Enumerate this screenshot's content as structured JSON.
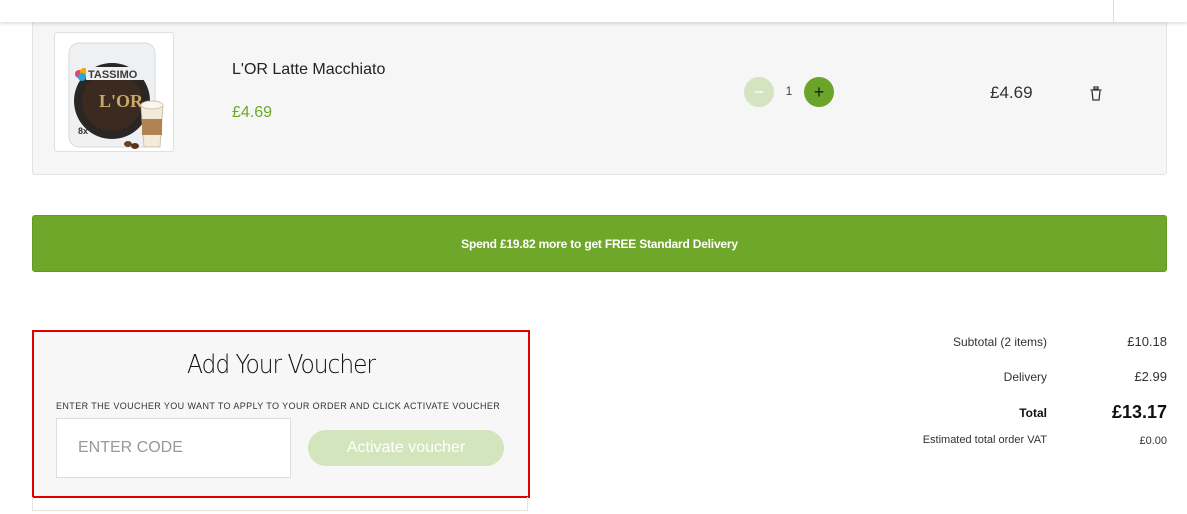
{
  "cart": {
    "item": {
      "image_brand": "TASSIMO",
      "image_pack_count": "8x",
      "name": "L'OR Latte Macchiato",
      "unit_price": "£4.69",
      "quantity": "1",
      "minus_symbol": "−",
      "plus_symbol": "+",
      "line_total": "£4.69"
    }
  },
  "delivery_banner": {
    "text": "Spend £19.82 more to get FREE Standard Delivery"
  },
  "voucher": {
    "title": "Add Your Voucher",
    "instructions": "ENTER THE VOUCHER YOU WANT TO APPLY TO YOUR ORDER AND CLICK ACTIVATE VOUCHER",
    "input_placeholder": "ENTER CODE",
    "activate_label": "Activate voucher"
  },
  "summary": {
    "subtotal_label": "Subtotal (2 items)",
    "subtotal_value": "£10.18",
    "delivery_label": "Delivery",
    "delivery_value": "£2.99",
    "total_label": "Total",
    "total_value": "£13.17",
    "vat_label": "Estimated total order VAT",
    "vat_value": "£0.00"
  },
  "colors": {
    "brand_green": "#6ea72a",
    "disabled_green": "#d3e5bd",
    "highlight_red": "#e00000"
  }
}
